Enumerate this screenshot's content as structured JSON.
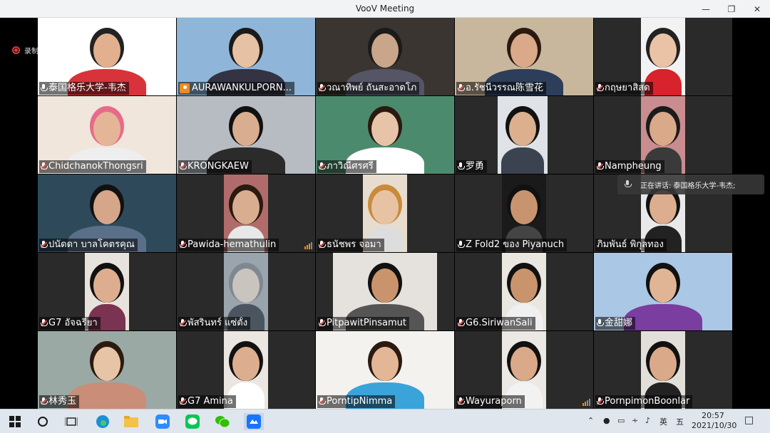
{
  "window": {
    "title": "VooV Meeting"
  },
  "recording": {
    "label": "录制中"
  },
  "speaking": {
    "label": "正在讲话: 泰国格乐大学-韦杰;"
  },
  "participants": [
    {
      "name": "泰国格乐大学-韦杰",
      "mic": "on"
    },
    {
      "name": "AURAWANKULPORN...",
      "mic": "avatar"
    },
    {
      "name": "วณาทิพย์ ถันสะอาดโภ",
      "mic": "muted"
    },
    {
      "name": "อ.รัชนีวรรณ陈雪花",
      "mic": "muted"
    },
    {
      "name": "กฤษยาสิสด",
      "mic": "muted"
    },
    {
      "name": "ChidchanokThongsri",
      "mic": "muted"
    },
    {
      "name": "KRONGKAEW",
      "mic": "muted"
    },
    {
      "name": "ภาวิณีศรศรี",
      "mic": "muted"
    },
    {
      "name": "罗勇",
      "mic": "on"
    },
    {
      "name": "Nampheung",
      "mic": "muted"
    },
    {
      "name": "ปนัดดา บาลโคตรคุณ",
      "mic": "muted"
    },
    {
      "name": "Pawida-hemathulin",
      "mic": "muted",
      "audio_level": 0.8
    },
    {
      "name": "ธนัชพร จอมา",
      "mic": "muted"
    },
    {
      "name": "Z Fold2 ของ Piyanuch",
      "mic": "on"
    },
    {
      "name": "ภิมพันธ์ พิกุลทอง",
      "mic": "none"
    },
    {
      "name": "G7 อัจฉรียา",
      "mic": "muted"
    },
    {
      "name": "พัสรินทร์ แซ่ตั้ง",
      "mic": "muted"
    },
    {
      "name": "PitpawitPinsamut",
      "mic": "muted"
    },
    {
      "name": "G6.SiriwanSali",
      "mic": "muted"
    },
    {
      "name": "金甜娜",
      "mic": "on"
    },
    {
      "name": "林秀玉",
      "mic": "muted"
    },
    {
      "name": "G7 Amina",
      "mic": "muted"
    },
    {
      "name": "PorntipNimma",
      "mic": "muted"
    },
    {
      "name": "Wayuraporn",
      "mic": "muted",
      "audio_level": 0.6
    },
    {
      "name": "PornpimonBoonlar",
      "mic": "muted"
    }
  ],
  "taskbar": {
    "tray_lang": "英",
    "tray_ime": "五",
    "time": "20:57",
    "date": "2021/10/30"
  },
  "colors": {
    "accent": "#f08a24",
    "muted": "#e54848"
  }
}
